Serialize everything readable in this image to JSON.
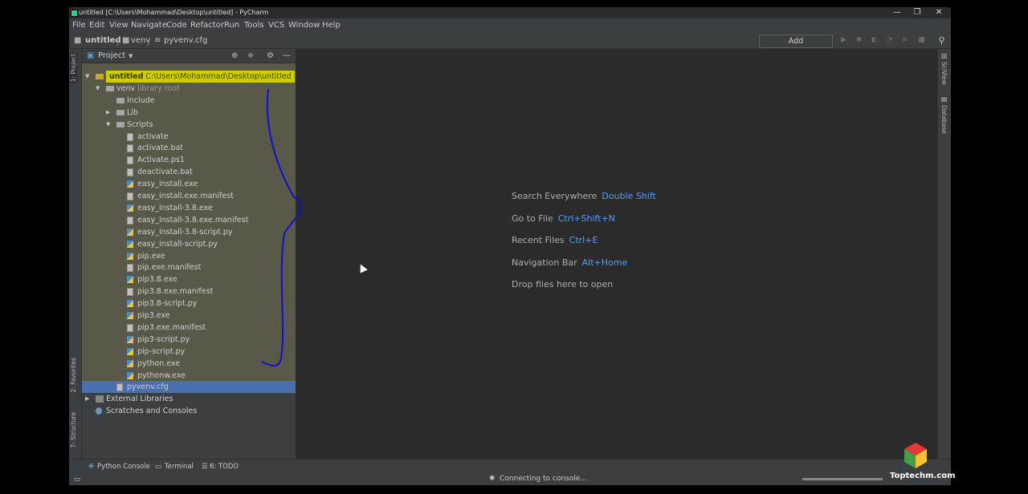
{
  "window": {
    "title": "untitled [C:\\Users\\Mohammad\\Desktop\\untitled] - PyCharm",
    "controls": [
      "—",
      "❐",
      "✕"
    ]
  },
  "menu": [
    "File",
    "Edit",
    "View",
    "Navigate",
    "Code",
    "Refactor",
    "Run",
    "Tools",
    "VCS",
    "Window",
    "Help"
  ],
  "breadcrumb": {
    "project": "untitled",
    "folder": "venv",
    "file": "pyvenv.cfg"
  },
  "toolbar": {
    "add_configuration": "Add Configuration..."
  },
  "left_tabs": {
    "project": "1: Project",
    "favorites": "2: Favorites",
    "structure": "7: Structure"
  },
  "right_tabs": {
    "sciview": "SciView",
    "database": "Database"
  },
  "project_panel": {
    "title": "Project",
    "tree": [
      {
        "label": "untitled",
        "extra": "C:\\Users\\Mohammad\\Desktop\\untitled",
        "indent": 0,
        "arrow": "▼",
        "type": "folder"
      },
      {
        "label": "venv",
        "extra": "library root",
        "indent": 1,
        "arrow": "▼",
        "type": "folder"
      },
      {
        "label": "Include",
        "extra": "",
        "indent": 2,
        "arrow": "",
        "type": "folder"
      },
      {
        "label": "Lib",
        "extra": "",
        "indent": 2,
        "arrow": "▶",
        "type": "folder"
      },
      {
        "label": "Scripts",
        "extra": "",
        "indent": 2,
        "arrow": "▼",
        "type": "folder"
      },
      {
        "label": "activate",
        "extra": "",
        "indent": 3,
        "arrow": "",
        "type": "file"
      },
      {
        "label": "activate.bat",
        "extra": "",
        "indent": 3,
        "arrow": "",
        "type": "file"
      },
      {
        "label": "Activate.ps1",
        "extra": "",
        "indent": 3,
        "arrow": "",
        "type": "file"
      },
      {
        "label": "deactivate.bat",
        "extra": "",
        "indent": 3,
        "arrow": "",
        "type": "file"
      },
      {
        "label": "easy_install.exe",
        "extra": "",
        "indent": 3,
        "arrow": "",
        "type": "py"
      },
      {
        "label": "easy_install.exe.manifest",
        "extra": "",
        "indent": 3,
        "arrow": "",
        "type": "file"
      },
      {
        "label": "easy_install-3.8.exe",
        "extra": "",
        "indent": 3,
        "arrow": "",
        "type": "py"
      },
      {
        "label": "easy_install-3.8.exe.manifest",
        "extra": "",
        "indent": 3,
        "arrow": "",
        "type": "file"
      },
      {
        "label": "easy_install-3.8-script.py",
        "extra": "",
        "indent": 3,
        "arrow": "",
        "type": "py"
      },
      {
        "label": "easy_install-script.py",
        "extra": "",
        "indent": 3,
        "arrow": "",
        "type": "py"
      },
      {
        "label": "pip.exe",
        "extra": "",
        "indent": 3,
        "arrow": "",
        "type": "py"
      },
      {
        "label": "pip.exe.manifest",
        "extra": "",
        "indent": 3,
        "arrow": "",
        "type": "file"
      },
      {
        "label": "pip3.8.exe",
        "extra": "",
        "indent": 3,
        "arrow": "",
        "type": "py"
      },
      {
        "label": "pip3.8.exe.manifest",
        "extra": "",
        "indent": 3,
        "arrow": "",
        "type": "file"
      },
      {
        "label": "pip3.8-script.py",
        "extra": "",
        "indent": 3,
        "arrow": "",
        "type": "py"
      },
      {
        "label": "pip3.exe",
        "extra": "",
        "indent": 3,
        "arrow": "",
        "type": "py"
      },
      {
        "label": "pip3.exe.manifest",
        "extra": "",
        "indent": 3,
        "arrow": "",
        "type": "file"
      },
      {
        "label": "pip3-script.py",
        "extra": "",
        "indent": 3,
        "arrow": "",
        "type": "py"
      },
      {
        "label": "pip-script.py",
        "extra": "",
        "indent": 3,
        "arrow": "",
        "type": "py"
      },
      {
        "label": "python.exe",
        "extra": "",
        "indent": 3,
        "arrow": "",
        "type": "py"
      },
      {
        "label": "pythonw.exe",
        "extra": "",
        "indent": 3,
        "arrow": "",
        "type": "py"
      },
      {
        "label": "pyvenv.cfg",
        "extra": "",
        "indent": 2,
        "arrow": "",
        "type": "file"
      },
      {
        "label": "External Libraries",
        "extra": "",
        "indent": 0,
        "arrow": "▶",
        "type": "lib"
      },
      {
        "label": "Scratches and Consoles",
        "extra": "",
        "indent": 0,
        "arrow": "",
        "type": "scratch"
      }
    ]
  },
  "editor_hints": [
    {
      "text": "Search Everywhere",
      "key": "Double Shift"
    },
    {
      "text": "Go to File",
      "key": "Ctrl+Shift+N"
    },
    {
      "text": "Recent Files",
      "key": "Ctrl+E"
    },
    {
      "text": "Navigation Bar",
      "key": "Alt+Home"
    },
    {
      "text": "Drop files here to open",
      "key": ""
    }
  ],
  "bottom_tabs": {
    "python_console": "Python Console",
    "terminal": "Terminal",
    "todo": "6: TODO"
  },
  "status": {
    "message": "Connecting to console..."
  },
  "watermark": "Toptechm.com",
  "colors": {
    "editor_bg": "#2b2b2b",
    "panel_bg": "#3c3f41",
    "selection": "#4b6eaf",
    "shortcut": "#589df6",
    "highlight": "#cccc00",
    "annotation": "#1010d0"
  }
}
